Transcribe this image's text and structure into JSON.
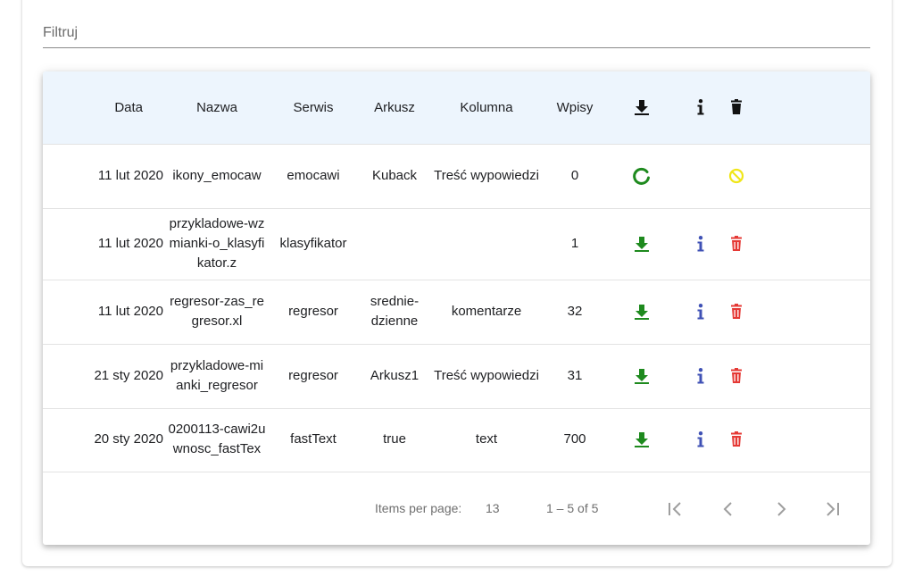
{
  "filter": {
    "placeholder": "Filtruj",
    "value": ""
  },
  "colors": {
    "download_green": "#1e8a1e",
    "info_blue": "#3f51b5",
    "delete_red": "#e53935",
    "loading_green": "#1e8a1e",
    "blocked_yellow": "#f0e619",
    "header_bg": "#edf5fd"
  },
  "table": {
    "headers": [
      "Data",
      "Nazwa",
      "Serwis",
      "Arkusz",
      "Kolumna",
      "Wpisy"
    ],
    "header_icons": [
      "download-icon",
      "info-icon",
      "trash-icon"
    ],
    "rows": [
      {
        "date": "11 lut 2020",
        "name": "ikony_emocaw",
        "service": "emocawi",
        "sheet": "Kuback",
        "column": "Treść wypowiedzi",
        "entries": "0",
        "status": "loading"
      },
      {
        "date": "11 lut 2020",
        "name": "przykladowe-wzmianki-o_klasyfikator.z",
        "service": "klasyfikator",
        "sheet": "",
        "column": "",
        "entries": "1",
        "status": "ready"
      },
      {
        "date": "11 lut 2020",
        "name": "regresor-zas_regresor.xl",
        "service": "regresor",
        "sheet": "srednie-dzienne",
        "column": "komentarze",
        "entries": "32",
        "status": "ready"
      },
      {
        "date": "21 sty 2020",
        "name": "przykladowe-mianki_regresor",
        "service": "regresor",
        "sheet": "Arkusz1",
        "column": "Treść wypowiedzi",
        "entries": "31",
        "status": "ready"
      },
      {
        "date": "20 sty 2020",
        "name": "0200113-cawi2uwnosc_fastTex",
        "service": "fastText",
        "sheet": "true",
        "column": "text",
        "entries": "700",
        "status": "ready"
      }
    ]
  },
  "paginator": {
    "items_per_page_label": "Items per page:",
    "items_per_page": "13",
    "range": "1 – 5 of 5"
  }
}
